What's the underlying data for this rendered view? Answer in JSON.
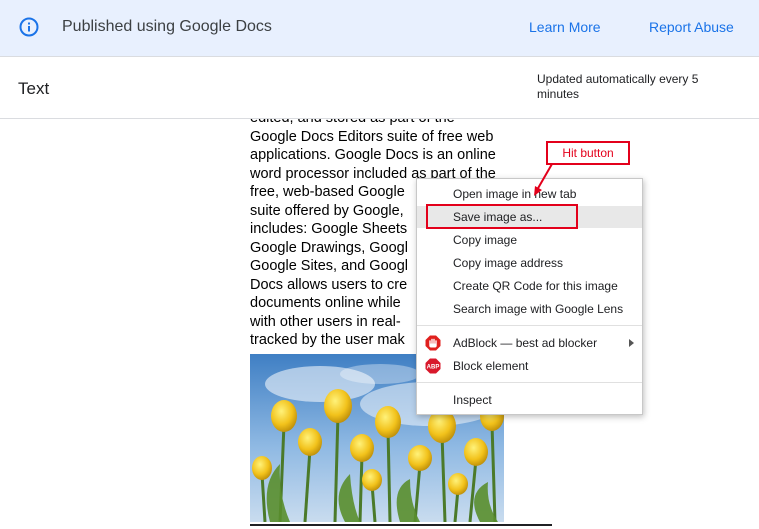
{
  "banner": {
    "text": "Published using Google Docs",
    "learn_more": "Learn More",
    "report_abuse": "Report Abuse",
    "icon": "info-icon"
  },
  "header": {
    "title": "Text",
    "updated": "Updated automatically every 5 minutes"
  },
  "doc": {
    "lines": [
      "edited, and stored as part of the",
      "Google Docs Editors suite of free web",
      "applications. Google Docs is an online",
      "word processor included as part of the",
      "free, web-based Google",
      "suite offered by Google,",
      "includes: Google Sheets",
      "Google Drawings, Googl",
      "Google Sites, and Googl",
      "Docs allows users to cre",
      "documents online while",
      "with other users in real-",
      "tracked by the user mak"
    ]
  },
  "context_menu": {
    "items": [
      "Open image in new tab",
      "Save image as...",
      "Copy image",
      "Copy image address",
      "Create QR Code for this image",
      "Search image with Google Lens"
    ],
    "extensions": [
      "AdBlock — best ad blocker",
      "Block element"
    ],
    "inspect": "Inspect",
    "abp_badge": "ABP"
  },
  "annotation": {
    "callout": "Hit button",
    "color": "#e3001b"
  },
  "colors": {
    "banner_bg": "#e8f0fe",
    "link": "#1a73e8",
    "highlight": "#e8e8e8"
  }
}
